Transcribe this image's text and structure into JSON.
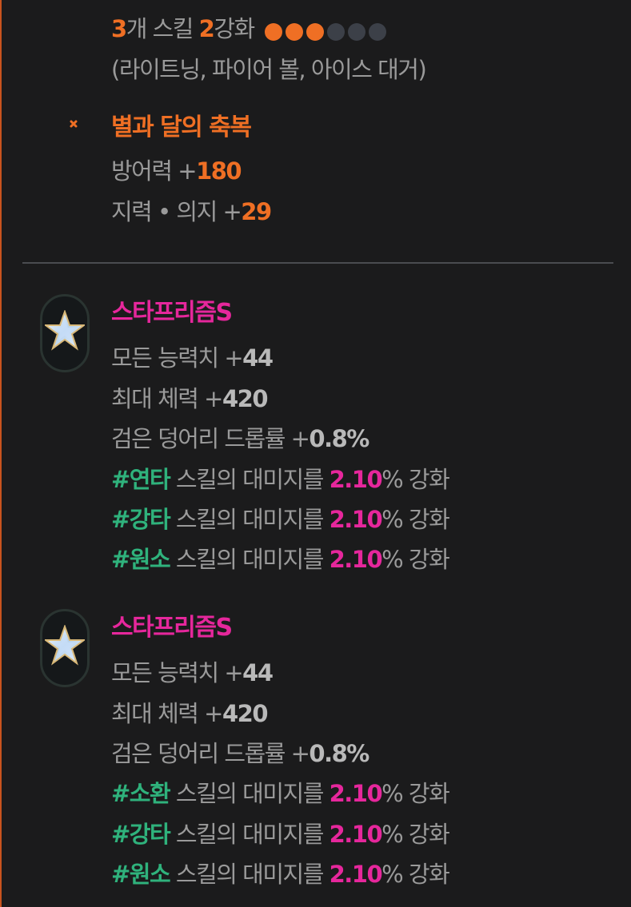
{
  "set_bonus": {
    "count": "3",
    "count_suffix": "개 스킬 ",
    "level": "2",
    "level_suffix": "강화",
    "enhance_dots": {
      "filled": 3,
      "total": 6
    },
    "skills_line": "(라이트닝, 파이어 볼, 아이스 대거)"
  },
  "blessing": {
    "icon": "moon-star-icon",
    "title": "별과 달의 축복",
    "stat1_label": "방어력 +",
    "stat1_value": "180",
    "stat2_label": "지력 • 의지 +",
    "stat2_value": "29"
  },
  "gems": [
    {
      "icon": "star-gem-icon",
      "title": "스타프리즘S",
      "all_stats_label": "모든 능력치 +",
      "all_stats_value": "44",
      "max_hp_label": "최대 체력 +",
      "max_hp_value": "420",
      "drop_label": "검은 덩어리 드롭률 +",
      "drop_value": "0.8%",
      "skills": [
        {
          "tag": "#연타",
          "text": " 스킬의 대미지를 ",
          "value": "2.10",
          "suffix": "% 강화"
        },
        {
          "tag": "#강타",
          "text": " 스킬의 대미지를 ",
          "value": "2.10",
          "suffix": "% 강화"
        },
        {
          "tag": "#원소",
          "text": " 스킬의 대미지를 ",
          "value": "2.10",
          "suffix": "% 강화"
        }
      ]
    },
    {
      "icon": "star-gem-icon",
      "title": "스타프리즘S",
      "all_stats_label": "모든 능력치 +",
      "all_stats_value": "44",
      "max_hp_label": "최대 체력 +",
      "max_hp_value": "420",
      "drop_label": "검은 덩어리 드롭률 +",
      "drop_value": "0.8%",
      "skills": [
        {
          "tag": "#소환",
          "text": " 스킬의 대미지를 ",
          "value": "2.10",
          "suffix": "% 강화"
        },
        {
          "tag": "#강타",
          "text": " 스킬의 대미지를 ",
          "value": "2.10",
          "suffix": "% 강화"
        },
        {
          "tag": "#원소",
          "text": " 스킬의 대미지를 ",
          "value": "2.10",
          "suffix": "% 강화"
        }
      ]
    }
  ],
  "colors": {
    "accent_orange": "#ef6f24",
    "accent_pink": "#e6279c",
    "accent_green": "#2fb27c",
    "background": "#1b1b1c"
  }
}
